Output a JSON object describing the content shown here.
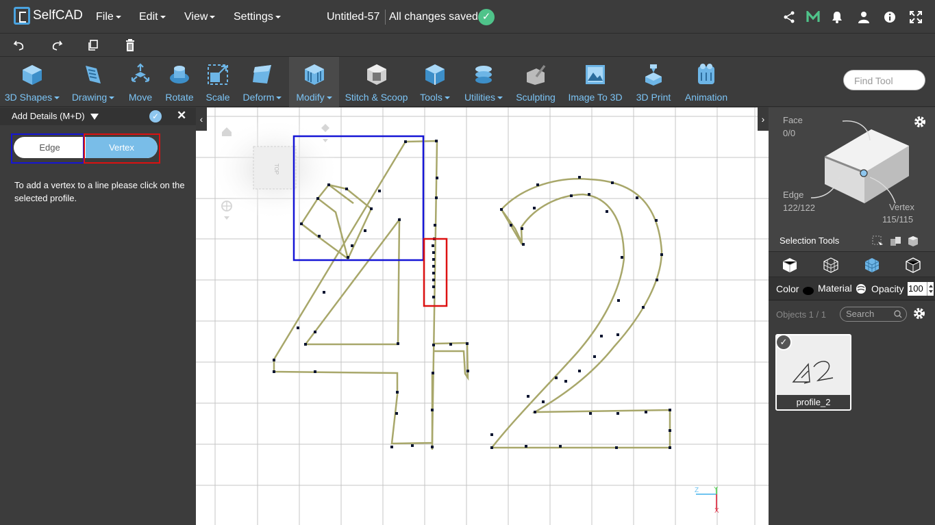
{
  "header": {
    "app_name": "SelfCAD",
    "menus": [
      "File",
      "Edit",
      "View",
      "Settings"
    ],
    "document_title": "Untitled-57",
    "save_status": "All changes saved"
  },
  "toolbar": {
    "tools": [
      {
        "label": "3D Shapes",
        "icon": "cube-icon",
        "dropdown": true
      },
      {
        "label": "Drawing",
        "icon": "drawing-icon",
        "dropdown": true
      },
      {
        "label": "Move",
        "icon": "move-icon",
        "dropdown": false
      },
      {
        "label": "Rotate",
        "icon": "rotate-icon",
        "dropdown": false
      },
      {
        "label": "Scale",
        "icon": "scale-icon",
        "dropdown": false
      },
      {
        "label": "Deform",
        "icon": "deform-icon",
        "dropdown": true
      },
      {
        "label": "Modify",
        "icon": "modify-icon",
        "dropdown": true
      },
      {
        "label": "Stitch & Scoop",
        "icon": "stitch-scoop-icon",
        "dropdown": false
      },
      {
        "label": "Tools",
        "icon": "tools-icon",
        "dropdown": true
      },
      {
        "label": "Utilities",
        "icon": "utilities-icon",
        "dropdown": true
      },
      {
        "label": "Sculpting",
        "icon": "sculpting-icon",
        "dropdown": false
      },
      {
        "label": "Image To 3D",
        "icon": "image-to-3d-icon",
        "dropdown": false
      },
      {
        "label": "3D Print",
        "icon": "3d-print-icon",
        "dropdown": false
      },
      {
        "label": "Animation",
        "icon": "animation-icon",
        "dropdown": false
      }
    ],
    "find_placeholder": "Find Tool"
  },
  "left_panel": {
    "title": "Add Details (M+D)",
    "toggle_edge": "Edge",
    "toggle_vertex": "Vertex",
    "toggle_selected": "Vertex",
    "instruction": "To add a vertex to a line please click on the selected profile."
  },
  "viewport": {
    "view_cube_label": "TOP",
    "axis_labels": {
      "z": "Z",
      "y": "Y",
      "x": "X"
    }
  },
  "right_panel": {
    "face_label": "Face",
    "face_count": "0/0",
    "edge_label": "Edge",
    "edge_count": "122/122",
    "vertex_label": "Vertex",
    "vertex_count": "115/115",
    "selection_tools": "Selection Tools",
    "color_label": "Color",
    "material_label": "Material",
    "opacity_label": "Opacity",
    "opacity_value": "100",
    "objects_count": "Objects 1 / 1",
    "search_placeholder": "Search",
    "object_name": "profile_2"
  },
  "colors": {
    "accent": "#7cc4f5",
    "highlight_blue": "#1515d6",
    "highlight_red": "#dd1111",
    "profile_line": "#a8a76a",
    "vertex": "#0a1530"
  }
}
